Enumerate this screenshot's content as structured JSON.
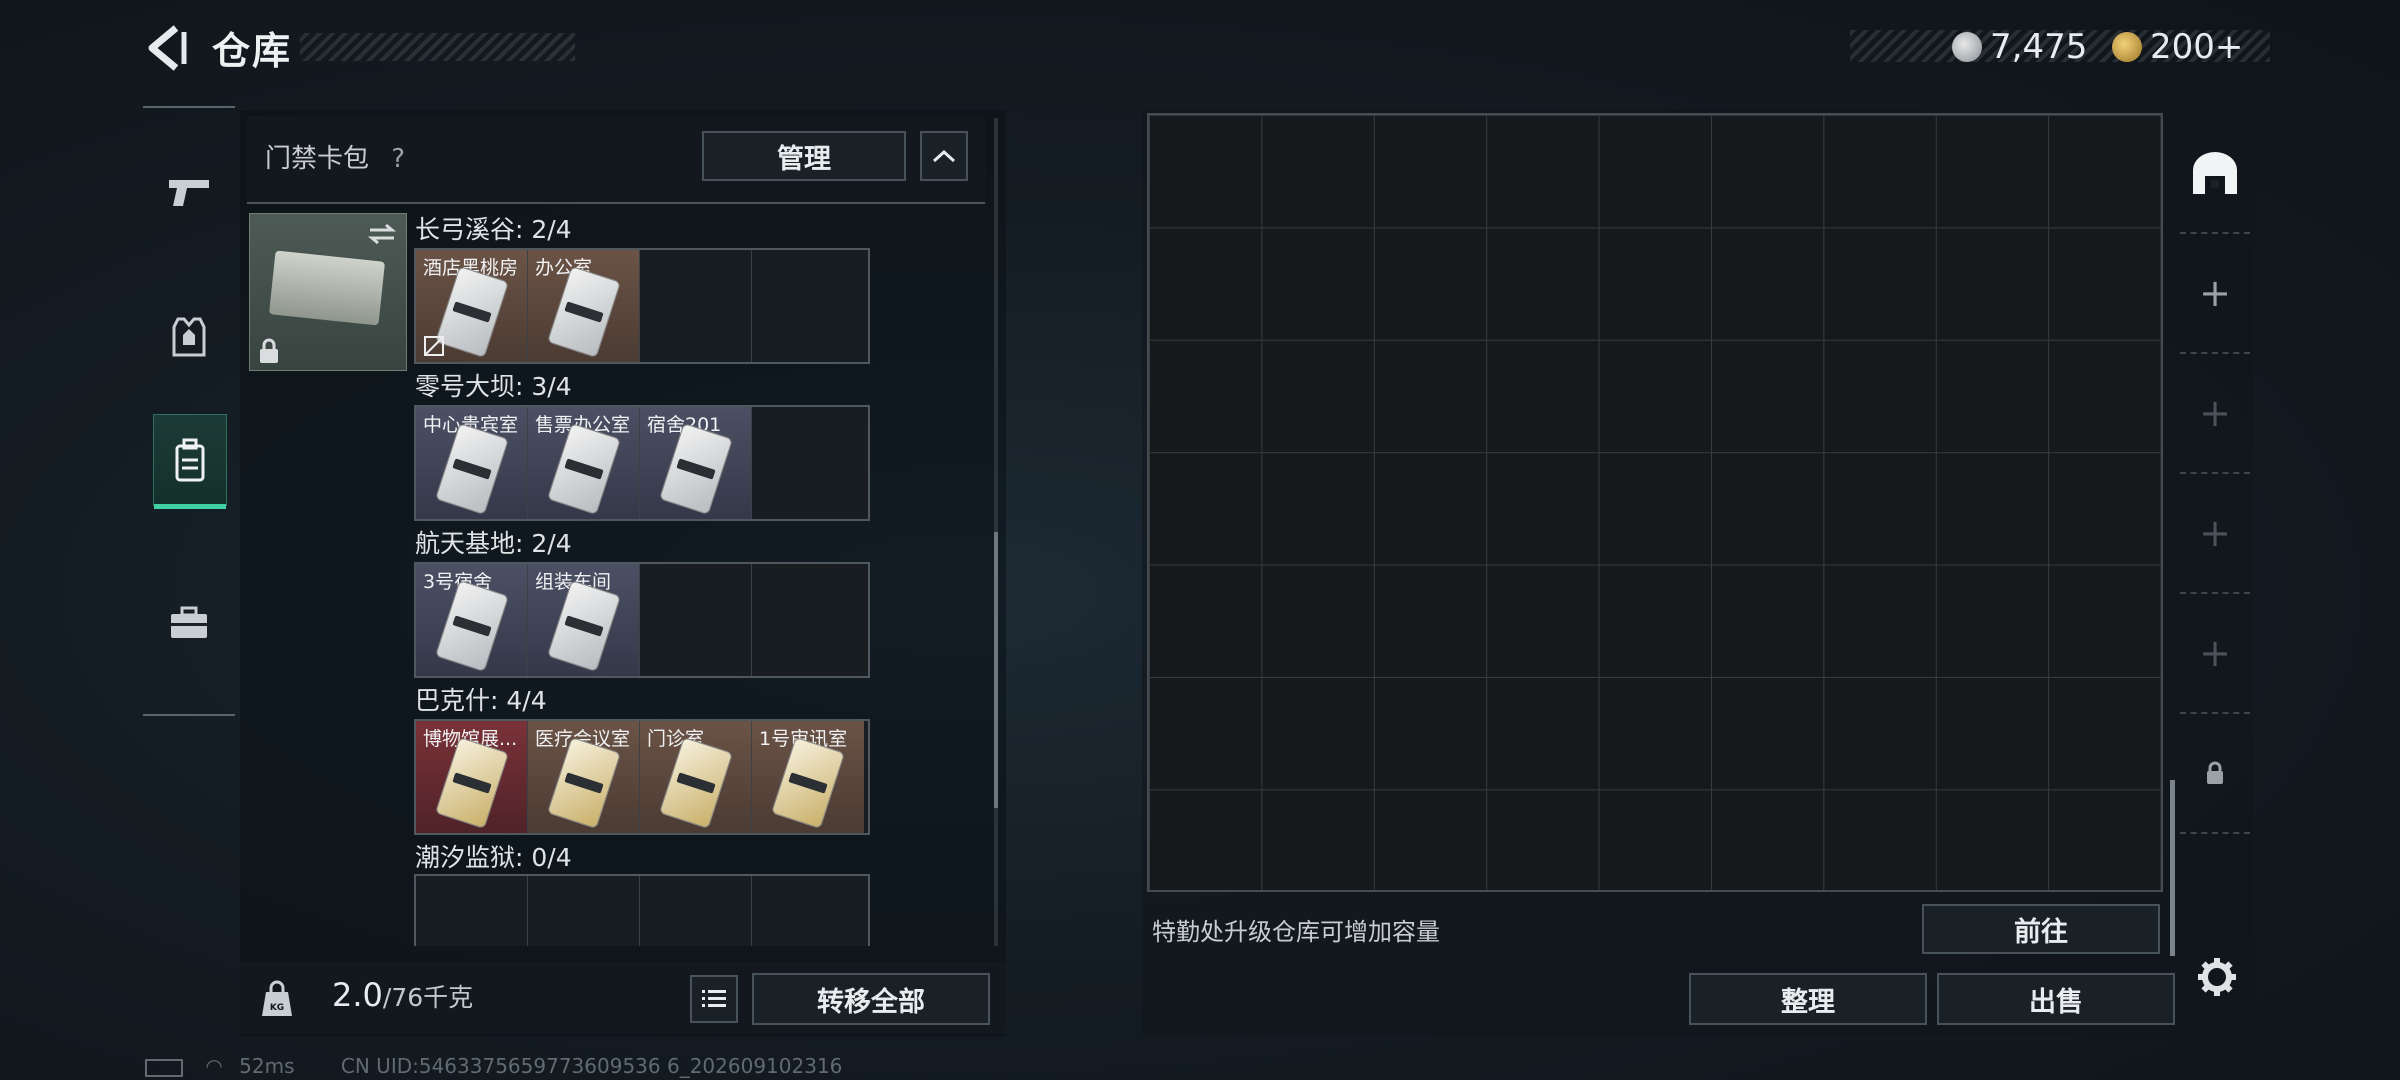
{
  "header": {
    "title": "仓库",
    "currency_silver": "7,475",
    "currency_gold": "200+"
  },
  "left_rail": {
    "items": [
      {
        "name": "weapons-tab"
      },
      {
        "name": "armor-tab"
      },
      {
        "name": "backpack-tab",
        "active": true
      },
      {
        "name": "case-tab"
      }
    ]
  },
  "section": {
    "title": "门禁卡包",
    "help": "?",
    "manage_label": "管理"
  },
  "areas": [
    {
      "label": "长弓溪谷: 2/4",
      "color": "brown",
      "cards": [
        "酒店黑桃房",
        "办公室"
      ]
    },
    {
      "label": "零号大坝: 3/4",
      "color": "navy",
      "cards": [
        "中心贵宾室",
        "售票办公室",
        "宿舍201"
      ]
    },
    {
      "label": "航天基地: 2/4",
      "color": "navy",
      "cards": [
        "3号宿舍",
        "组装车间"
      ]
    },
    {
      "label": "巴克什: 4/4",
      "color": "mixed",
      "cards": [
        "博物馆展...",
        "医疗会议室",
        "门诊室",
        "1号审讯室"
      ]
    },
    {
      "label": "潮汐监狱: 0/4",
      "color": "empty",
      "cards": []
    }
  ],
  "bottom_left": {
    "weight_current": "2.0",
    "weight_max": "/76千克",
    "transfer_all_label": "转移全部"
  },
  "storage": {
    "upgrade_hint": "特勤处升级仓库可增加容量",
    "goto_label": "前往",
    "sort_label": "整理",
    "sell_label": "出售"
  },
  "status_bar": {
    "ping": "52ms",
    "uid": "CN UID:5463375659773609536 6_202609102316"
  },
  "colors": {
    "accent": "#3fd1a4",
    "panel_border": "#47525a"
  }
}
